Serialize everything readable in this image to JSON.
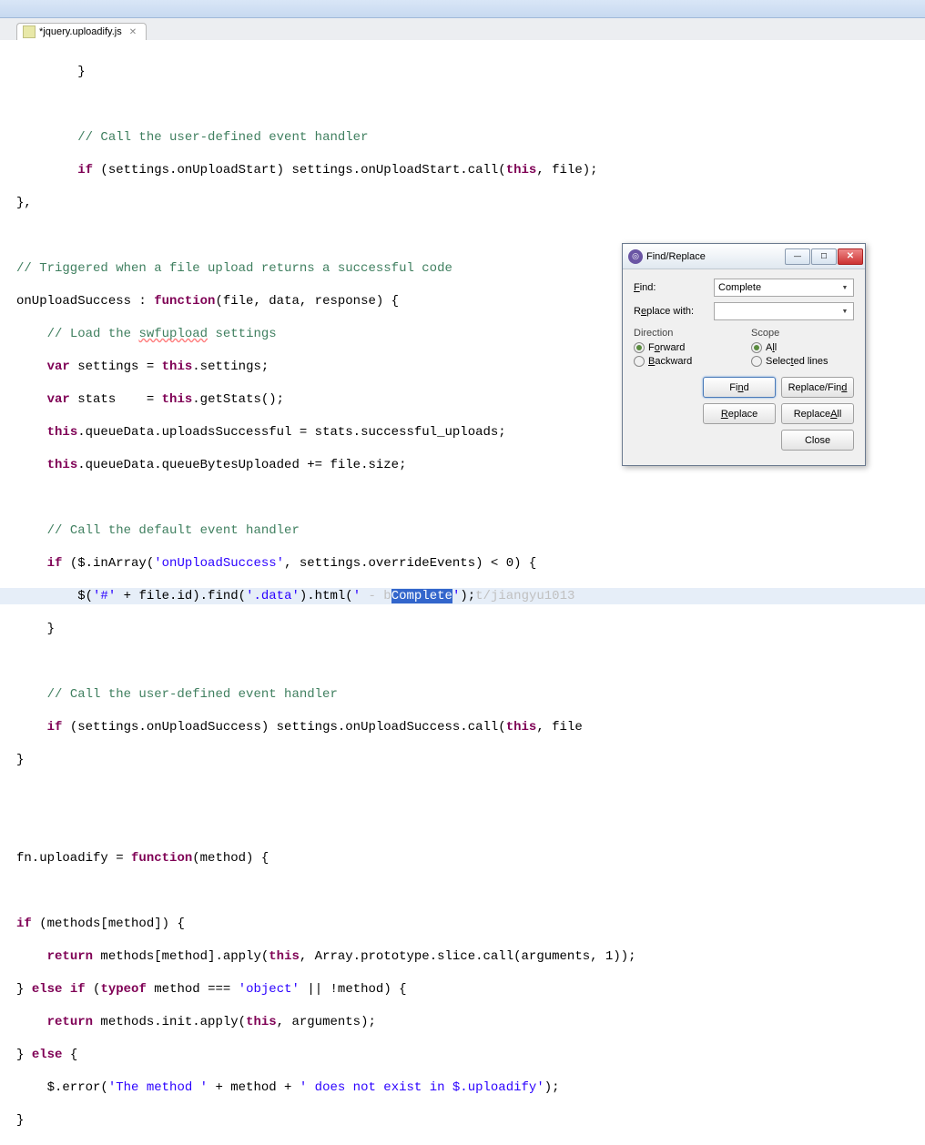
{
  "tab": {
    "title": "*jquery.uploadify.js",
    "close_glyph": "✕"
  },
  "code": {
    "l1": "        }",
    "l2": "",
    "l3_a": "        ",
    "l3_b": "// Call the user-defined event handler",
    "l4_a": "        ",
    "l4_b": "if",
    "l4_c": " (settings.onUploadStart) settings.onUploadStart.call(",
    "l4_d": "this",
    "l4_e": ", file);",
    "l5": "},",
    "l6": "",
    "l7": "// Triggered when a file upload returns a successful code",
    "l8_a": "onUploadSuccess : ",
    "l8_b": "function",
    "l8_c": "(file, data, response) {",
    "l9_a": "    ",
    "l9_b": "// Load the ",
    "l9_c": "swfupload",
    "l9_d": " settings",
    "l10_a": "    ",
    "l10_b": "var",
    "l10_c": " settings = ",
    "l10_d": "this",
    "l10_e": ".settings;",
    "l11_a": "    ",
    "l11_b": "var",
    "l11_c": " stats    = ",
    "l11_d": "this",
    "l11_e": ".getStats();",
    "l12_a": "    ",
    "l12_b": "this",
    "l12_c": ".queueData.uploadsSuccessful = stats.successful_uploads;",
    "l13_a": "    ",
    "l13_b": "this",
    "l13_c": ".queueData.queueBytesUploaded += file.size;",
    "l14": "",
    "l15_a": "    ",
    "l15_b": "// Call the default event handler",
    "l16_a": "    ",
    "l16_b": "if",
    "l16_c": " ($.inArray(",
    "l16_d": "'onUploadSuccess'",
    "l16_e": ", settings.overrideEvents) < 0) {",
    "l17_a": "        $(",
    "l17_b": "'#'",
    "l17_c": " + file.id).find(",
    "l17_d": "'.data'",
    "l17_e": ").html(",
    "l17_f": "' ",
    "l17_wm1": "- b",
    "l17_sel": "Complete",
    "l17_g": "'",
    "l17_h": ");",
    "l17_wm2": "t/jiangyu1013",
    "l18": "    }",
    "l19": "",
    "l20_a": "    ",
    "l20_b": "// Call the user-defined event handler",
    "l21_a": "    ",
    "l21_b": "if",
    "l21_c": " (settings.onUploadSuccess) settings.onUploadSuccess.call(",
    "l21_d": "this",
    "l21_e": ", file",
    "l22": "}",
    "l23": "",
    "l24": "",
    "l25_a": "fn.uploadify = ",
    "l25_b": "function",
    "l25_c": "(method) {",
    "l26": "",
    "l27_a": "if",
    "l27_b": " (methods[method]) {",
    "l28_a": "    ",
    "l28_b": "return",
    "l28_c": " methods[method].apply(",
    "l28_d": "this",
    "l28_e": ", Array.prototype.slice.call(arguments, 1));",
    "l29_a": "} ",
    "l29_b": "else",
    "l29_c": " ",
    "l29_d": "if",
    "l29_e": " (",
    "l29_f": "typeof",
    "l29_g": " method === ",
    "l29_h": "'object'",
    "l29_i": " || !method) {",
    "l30_a": "    ",
    "l30_b": "return",
    "l30_c": " methods.init.apply(",
    "l30_d": "this",
    "l30_e": ", arguments);",
    "l31_a": "} ",
    "l31_b": "else",
    "l31_c": " {",
    "l32_a": "    $.error(",
    "l32_b": "'The method '",
    "l32_c": " + method + ",
    "l32_d": "' does not exist in $.uploadify'",
    "l32_e": ");",
    "l33": "}"
  },
  "dialog": {
    "title": "Find/Replace",
    "find_label": "Find:",
    "replace_label": "Replace with:",
    "find_value": "Complete",
    "replace_value": "",
    "direction_title": "Direction",
    "scope_title": "Scope",
    "forward": "Forward",
    "backward": "Backward",
    "all": "All",
    "selected": "Selected lines",
    "btn_find": "Find",
    "btn_replace_find": "Replace/Find",
    "btn_replace": "Replace",
    "btn_replace_all": "Replace All",
    "btn_close": "Close",
    "min_glyph": "—",
    "max_glyph": "☐",
    "close_glyph": "✕"
  }
}
